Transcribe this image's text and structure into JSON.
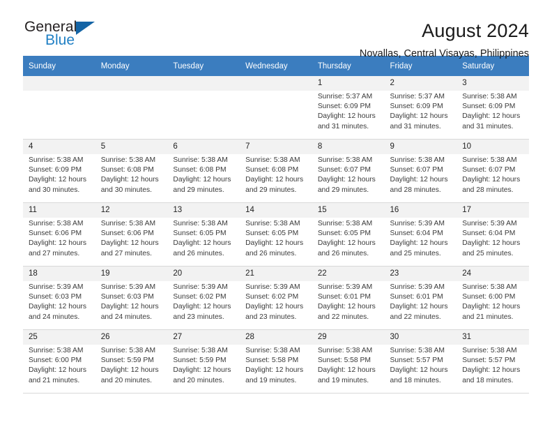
{
  "brand": {
    "name_part1": "General",
    "name_part2": "Blue",
    "flag_icon": "triangle-flag-icon"
  },
  "header": {
    "title": "August 2024",
    "subtitle": "Novallas, Central Visayas, Philippines"
  },
  "calendar": {
    "weekday_headers": [
      "Sunday",
      "Monday",
      "Tuesday",
      "Wednesday",
      "Thursday",
      "Friday",
      "Saturday"
    ],
    "header_bg": "#3b7dbf",
    "daynum_bg": "#f2f2f2",
    "labels": {
      "sunrise": "Sunrise:",
      "sunset": "Sunset:",
      "daylight": "Daylight:"
    },
    "weeks": [
      [
        {
          "day": "",
          "sunrise": "",
          "sunset": "",
          "daylight_line1": "",
          "daylight_line2": "",
          "empty": true
        },
        {
          "day": "",
          "sunrise": "",
          "sunset": "",
          "daylight_line1": "",
          "daylight_line2": "",
          "empty": true
        },
        {
          "day": "",
          "sunrise": "",
          "sunset": "",
          "daylight_line1": "",
          "daylight_line2": "",
          "empty": true
        },
        {
          "day": "",
          "sunrise": "",
          "sunset": "",
          "daylight_line1": "",
          "daylight_line2": "",
          "empty": true
        },
        {
          "day": "1",
          "sunrise": "Sunrise: 5:37 AM",
          "sunset": "Sunset: 6:09 PM",
          "daylight_line1": "Daylight: 12 hours",
          "daylight_line2": "and 31 minutes.",
          "empty": false
        },
        {
          "day": "2",
          "sunrise": "Sunrise: 5:37 AM",
          "sunset": "Sunset: 6:09 PM",
          "daylight_line1": "Daylight: 12 hours",
          "daylight_line2": "and 31 minutes.",
          "empty": false
        },
        {
          "day": "3",
          "sunrise": "Sunrise: 5:38 AM",
          "sunset": "Sunset: 6:09 PM",
          "daylight_line1": "Daylight: 12 hours",
          "daylight_line2": "and 31 minutes.",
          "empty": false
        }
      ],
      [
        {
          "day": "4",
          "sunrise": "Sunrise: 5:38 AM",
          "sunset": "Sunset: 6:09 PM",
          "daylight_line1": "Daylight: 12 hours",
          "daylight_line2": "and 30 minutes.",
          "empty": false
        },
        {
          "day": "5",
          "sunrise": "Sunrise: 5:38 AM",
          "sunset": "Sunset: 6:08 PM",
          "daylight_line1": "Daylight: 12 hours",
          "daylight_line2": "and 30 minutes.",
          "empty": false
        },
        {
          "day": "6",
          "sunrise": "Sunrise: 5:38 AM",
          "sunset": "Sunset: 6:08 PM",
          "daylight_line1": "Daylight: 12 hours",
          "daylight_line2": "and 29 minutes.",
          "empty": false
        },
        {
          "day": "7",
          "sunrise": "Sunrise: 5:38 AM",
          "sunset": "Sunset: 6:08 PM",
          "daylight_line1": "Daylight: 12 hours",
          "daylight_line2": "and 29 minutes.",
          "empty": false
        },
        {
          "day": "8",
          "sunrise": "Sunrise: 5:38 AM",
          "sunset": "Sunset: 6:07 PM",
          "daylight_line1": "Daylight: 12 hours",
          "daylight_line2": "and 29 minutes.",
          "empty": false
        },
        {
          "day": "9",
          "sunrise": "Sunrise: 5:38 AM",
          "sunset": "Sunset: 6:07 PM",
          "daylight_line1": "Daylight: 12 hours",
          "daylight_line2": "and 28 minutes.",
          "empty": false
        },
        {
          "day": "10",
          "sunrise": "Sunrise: 5:38 AM",
          "sunset": "Sunset: 6:07 PM",
          "daylight_line1": "Daylight: 12 hours",
          "daylight_line2": "and 28 minutes.",
          "empty": false
        }
      ],
      [
        {
          "day": "11",
          "sunrise": "Sunrise: 5:38 AM",
          "sunset": "Sunset: 6:06 PM",
          "daylight_line1": "Daylight: 12 hours",
          "daylight_line2": "and 27 minutes.",
          "empty": false
        },
        {
          "day": "12",
          "sunrise": "Sunrise: 5:38 AM",
          "sunset": "Sunset: 6:06 PM",
          "daylight_line1": "Daylight: 12 hours",
          "daylight_line2": "and 27 minutes.",
          "empty": false
        },
        {
          "day": "13",
          "sunrise": "Sunrise: 5:38 AM",
          "sunset": "Sunset: 6:05 PM",
          "daylight_line1": "Daylight: 12 hours",
          "daylight_line2": "and 26 minutes.",
          "empty": false
        },
        {
          "day": "14",
          "sunrise": "Sunrise: 5:38 AM",
          "sunset": "Sunset: 6:05 PM",
          "daylight_line1": "Daylight: 12 hours",
          "daylight_line2": "and 26 minutes.",
          "empty": false
        },
        {
          "day": "15",
          "sunrise": "Sunrise: 5:38 AM",
          "sunset": "Sunset: 6:05 PM",
          "daylight_line1": "Daylight: 12 hours",
          "daylight_line2": "and 26 minutes.",
          "empty": false
        },
        {
          "day": "16",
          "sunrise": "Sunrise: 5:39 AM",
          "sunset": "Sunset: 6:04 PM",
          "daylight_line1": "Daylight: 12 hours",
          "daylight_line2": "and 25 minutes.",
          "empty": false
        },
        {
          "day": "17",
          "sunrise": "Sunrise: 5:39 AM",
          "sunset": "Sunset: 6:04 PM",
          "daylight_line1": "Daylight: 12 hours",
          "daylight_line2": "and 25 minutes.",
          "empty": false
        }
      ],
      [
        {
          "day": "18",
          "sunrise": "Sunrise: 5:39 AM",
          "sunset": "Sunset: 6:03 PM",
          "daylight_line1": "Daylight: 12 hours",
          "daylight_line2": "and 24 minutes.",
          "empty": false
        },
        {
          "day": "19",
          "sunrise": "Sunrise: 5:39 AM",
          "sunset": "Sunset: 6:03 PM",
          "daylight_line1": "Daylight: 12 hours",
          "daylight_line2": "and 24 minutes.",
          "empty": false
        },
        {
          "day": "20",
          "sunrise": "Sunrise: 5:39 AM",
          "sunset": "Sunset: 6:02 PM",
          "daylight_line1": "Daylight: 12 hours",
          "daylight_line2": "and 23 minutes.",
          "empty": false
        },
        {
          "day": "21",
          "sunrise": "Sunrise: 5:39 AM",
          "sunset": "Sunset: 6:02 PM",
          "daylight_line1": "Daylight: 12 hours",
          "daylight_line2": "and 23 minutes.",
          "empty": false
        },
        {
          "day": "22",
          "sunrise": "Sunrise: 5:39 AM",
          "sunset": "Sunset: 6:01 PM",
          "daylight_line1": "Daylight: 12 hours",
          "daylight_line2": "and 22 minutes.",
          "empty": false
        },
        {
          "day": "23",
          "sunrise": "Sunrise: 5:39 AM",
          "sunset": "Sunset: 6:01 PM",
          "daylight_line1": "Daylight: 12 hours",
          "daylight_line2": "and 22 minutes.",
          "empty": false
        },
        {
          "day": "24",
          "sunrise": "Sunrise: 5:38 AM",
          "sunset": "Sunset: 6:00 PM",
          "daylight_line1": "Daylight: 12 hours",
          "daylight_line2": "and 21 minutes.",
          "empty": false
        }
      ],
      [
        {
          "day": "25",
          "sunrise": "Sunrise: 5:38 AM",
          "sunset": "Sunset: 6:00 PM",
          "daylight_line1": "Daylight: 12 hours",
          "daylight_line2": "and 21 minutes.",
          "empty": false
        },
        {
          "day": "26",
          "sunrise": "Sunrise: 5:38 AM",
          "sunset": "Sunset: 5:59 PM",
          "daylight_line1": "Daylight: 12 hours",
          "daylight_line2": "and 20 minutes.",
          "empty": false
        },
        {
          "day": "27",
          "sunrise": "Sunrise: 5:38 AM",
          "sunset": "Sunset: 5:59 PM",
          "daylight_line1": "Daylight: 12 hours",
          "daylight_line2": "and 20 minutes.",
          "empty": false
        },
        {
          "day": "28",
          "sunrise": "Sunrise: 5:38 AM",
          "sunset": "Sunset: 5:58 PM",
          "daylight_line1": "Daylight: 12 hours",
          "daylight_line2": "and 19 minutes.",
          "empty": false
        },
        {
          "day": "29",
          "sunrise": "Sunrise: 5:38 AM",
          "sunset": "Sunset: 5:58 PM",
          "daylight_line1": "Daylight: 12 hours",
          "daylight_line2": "and 19 minutes.",
          "empty": false
        },
        {
          "day": "30",
          "sunrise": "Sunrise: 5:38 AM",
          "sunset": "Sunset: 5:57 PM",
          "daylight_line1": "Daylight: 12 hours",
          "daylight_line2": "and 18 minutes.",
          "empty": false
        },
        {
          "day": "31",
          "sunrise": "Sunrise: 5:38 AM",
          "sunset": "Sunset: 5:57 PM",
          "daylight_line1": "Daylight: 12 hours",
          "daylight_line2": "and 18 minutes.",
          "empty": false
        }
      ]
    ]
  }
}
